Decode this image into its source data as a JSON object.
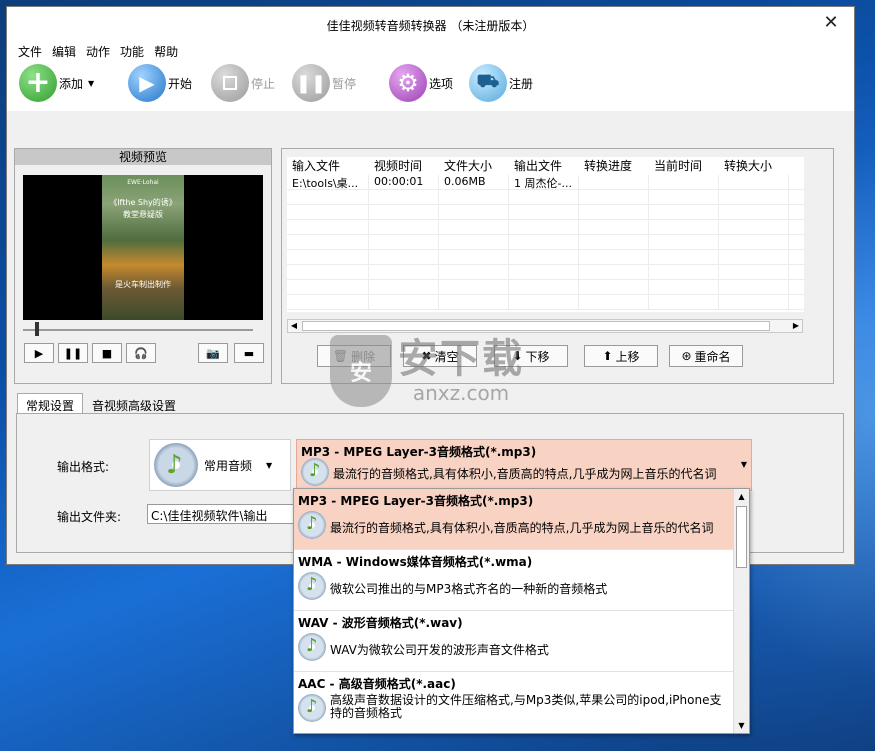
{
  "window": {
    "title": "佳佳视频转音频转换器 （未注册版本）",
    "close_glyph": "✕"
  },
  "menu": [
    "文件",
    "编辑",
    "动作",
    "功能",
    "帮助"
  ],
  "toolbar": {
    "add": "添加",
    "start": "开始",
    "stop": "停止",
    "pause": "暂停",
    "options": "选项",
    "register": "注册"
  },
  "preview": {
    "title": "视频预览",
    "overlay_top": "EWE·Lohai",
    "overlay_title": "《Ifthe Shy的诱》",
    "overlay_sub": "教堂悬疑版",
    "overlay_bottom": "是火车制出制作"
  },
  "file_table": {
    "columns": [
      "输入文件",
      "视频时间",
      "文件大小",
      "输出文件",
      "转换进度",
      "当前时间",
      "转换大小"
    ],
    "rows": [
      [
        "E:\\tools\\桌...",
        "00:00:01",
        "0.06MB",
        "1 周杰伦-...",
        "",
        "",
        ""
      ]
    ]
  },
  "list_buttons": {
    "delete": "删除",
    "clear": "清空",
    "down": "下移",
    "up": "上移",
    "rename": "重命名"
  },
  "tabs": [
    "常规设置",
    "音视频高级设置"
  ],
  "settings": {
    "output_format_label": "输出格式:",
    "category": "常用音频",
    "output_folder_label": "输出文件夹:",
    "output_folder_value": "C:\\佳佳视频软件\\输出"
  },
  "selected_format": {
    "title": "MP3 - MPEG Layer-3音频格式(*.mp3)",
    "desc": "最流行的音频格式,具有体积小,音质高的特点,几乎成为网上音乐的代名词"
  },
  "dropdown_items": [
    {
      "title": "MP3 - MPEG Layer-3音频格式(*.mp3)",
      "desc": "最流行的音频格式,具有体积小,音质高的特点,几乎成为网上音乐的代名词"
    },
    {
      "title": "WMA - Windows媒体音频格式(*.wma)",
      "desc": "微软公司推出的与MP3格式齐名的一种新的音频格式"
    },
    {
      "title": "WAV - 波形音频格式(*.wav)",
      "desc": "WAV为微软公司开发的波形声音文件格式"
    },
    {
      "title": "AAC - 高级音频格式(*.aac)",
      "desc": "高级声音数据设计的文件压缩格式,与Mp3类似,苹果公司的ipod,iPhone支持的音频格式"
    }
  ],
  "watermark": {
    "brand": "安下载",
    "site": "anxz.com",
    "shield_char": "安"
  }
}
